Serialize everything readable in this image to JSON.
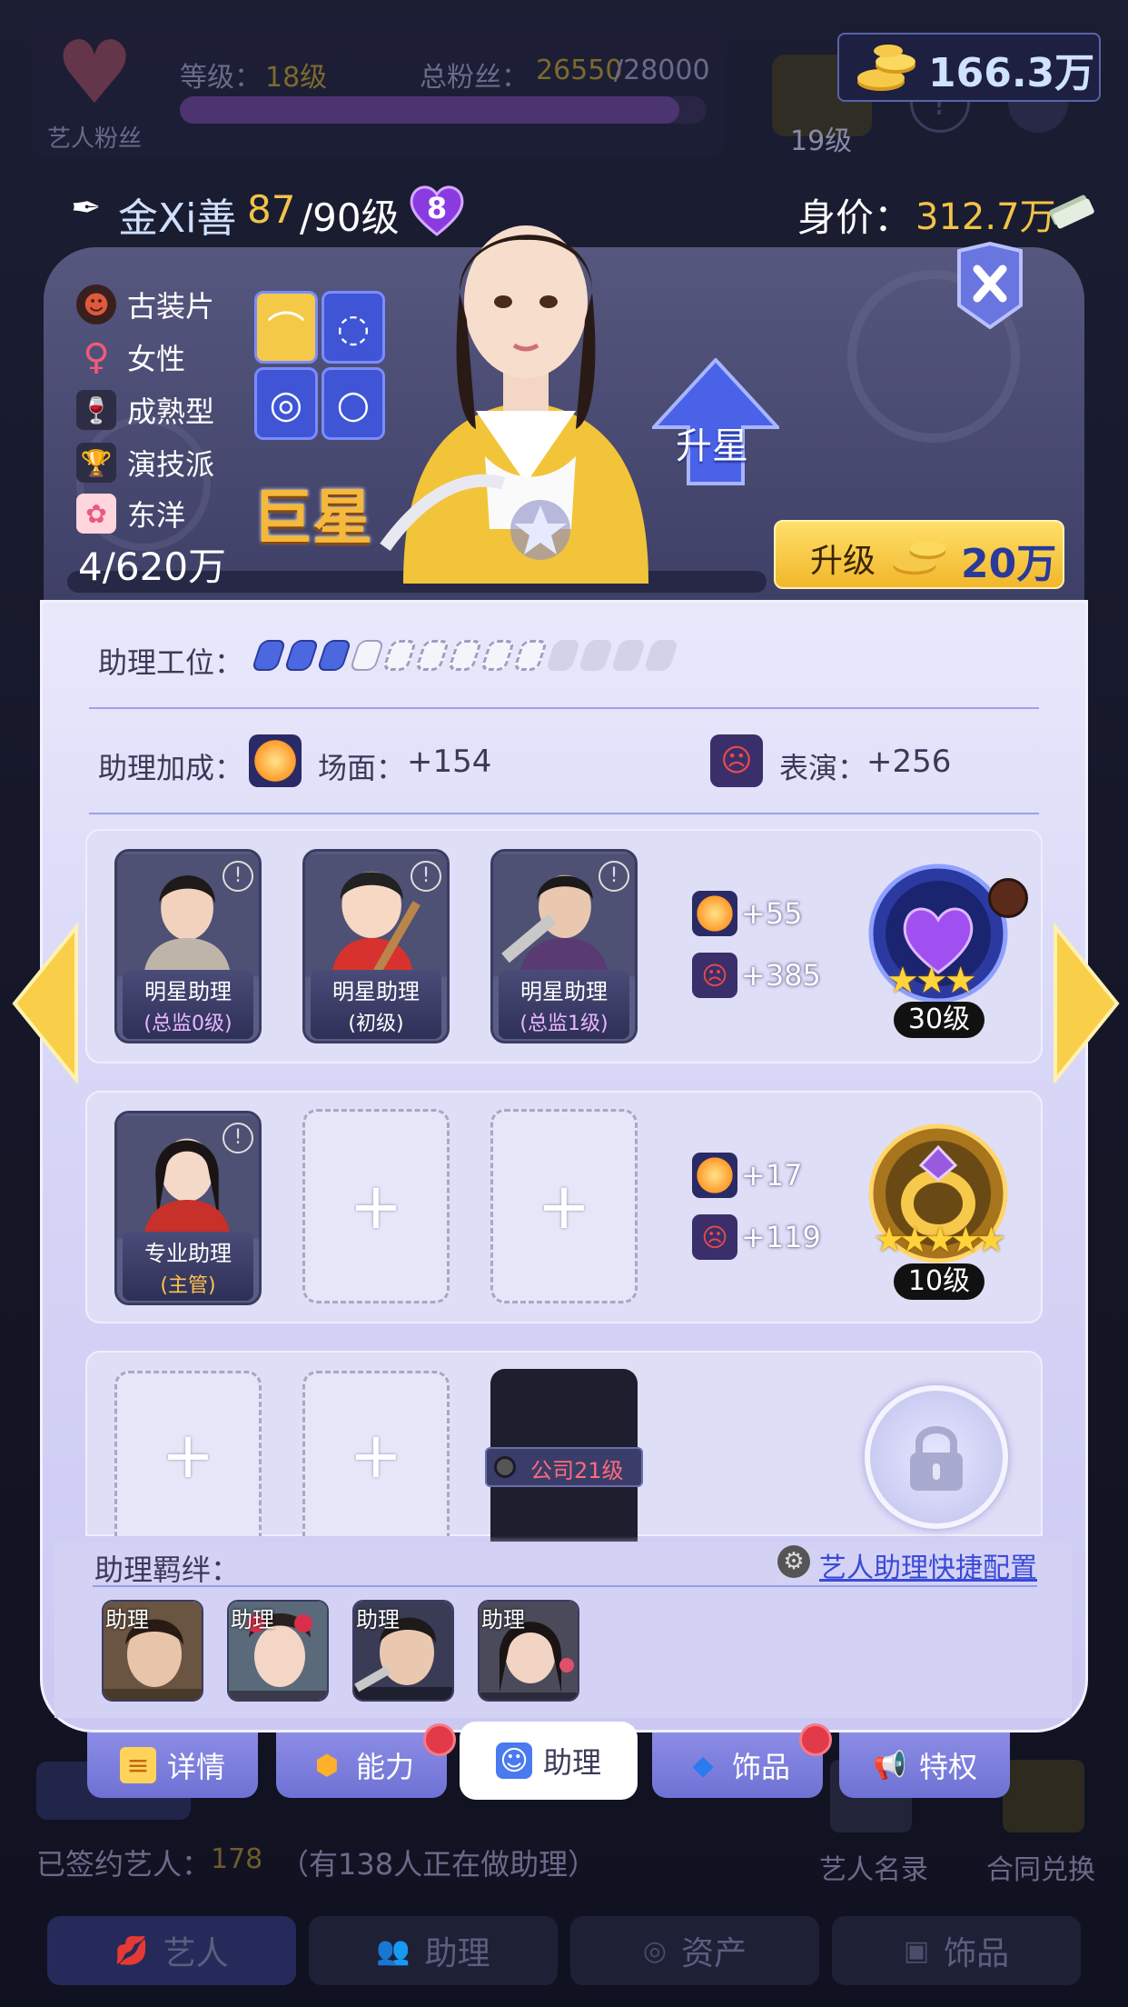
{
  "fans": {
    "title": "艺人粉丝",
    "level_label": "等级：",
    "level_value": "18级",
    "total_label": "总粉丝：",
    "total_value": "26550",
    "total_max": "/28000",
    "progress": 0.948
  },
  "side_level": "19级",
  "currency": {
    "icon": "gold-coins-icon",
    "value": "166.3万"
  },
  "artist": {
    "name": "金Xi善",
    "level": "87",
    "level_max": "/90级",
    "heart_count": "8",
    "worth_label": "身价：",
    "worth_value": "312.7万",
    "tags": [
      {
        "icon": "mask-icon",
        "label": "古装片"
      },
      {
        "icon": "female-icon",
        "label": "女性"
      },
      {
        "icon": "wine-glass-icon",
        "label": "成熟型"
      },
      {
        "icon": "trophy-icon",
        "label": "演技派"
      },
      {
        "icon": "flower-icon",
        "label": "东洋"
      }
    ],
    "rank": "巨星",
    "progress_text": "4/620万",
    "upgrade_star_label": "升星",
    "upgrade_label": "升级",
    "upgrade_cost": "20万"
  },
  "panel": {
    "slot_label": "助理工位：",
    "slots": {
      "filled": 4,
      "available": 5,
      "locked": 4
    },
    "bonus_label": "助理加成：",
    "bonus": [
      {
        "icon": "explosion-icon",
        "label": "场面：",
        "value": "+154"
      },
      {
        "icon": "drama-mask-icon",
        "label": "表演：",
        "value": "+256"
      }
    ],
    "rows": [
      {
        "cards": [
          {
            "name": "明星助理",
            "level": "(总监0级)"
          },
          {
            "name": "明星助理",
            "level": "(初级)"
          },
          {
            "name": "明星助理",
            "level": "(总监1级)"
          }
        ],
        "stats": [
          "+55",
          "+385"
        ],
        "medal_level": "30级",
        "medal_stars": 3
      },
      {
        "cards": [
          {
            "name": "专业助理",
            "level": "(主管)"
          }
        ],
        "stats": [
          "+17",
          "+119"
        ],
        "medal_level": "10级",
        "medal_stars": 5
      }
    ],
    "locked_tag": "公司21级",
    "empty_symbol": "+",
    "bond_label": "助理羁绊：",
    "bond_link": "艺人助理快捷配置",
    "bond_tag": "助理"
  },
  "tabs": [
    {
      "label": "详情",
      "icon": "clipboard-icon"
    },
    {
      "label": "能力",
      "icon": "hexagon-icon"
    },
    {
      "label": "助理",
      "icon": "assistant-badge-icon"
    },
    {
      "label": "饰品",
      "icon": "diamond-icon"
    },
    {
      "label": "特权",
      "icon": "megaphone-icon"
    }
  ],
  "bottom": {
    "signed_label": "已签约艺人：",
    "signed_value": "178",
    "signed_note": "（有138人正在做助理）",
    "list_label": "艺人名录",
    "contract_label": "合同兑换",
    "nav": [
      "艺人",
      "助理",
      "资产",
      "饰品"
    ]
  }
}
